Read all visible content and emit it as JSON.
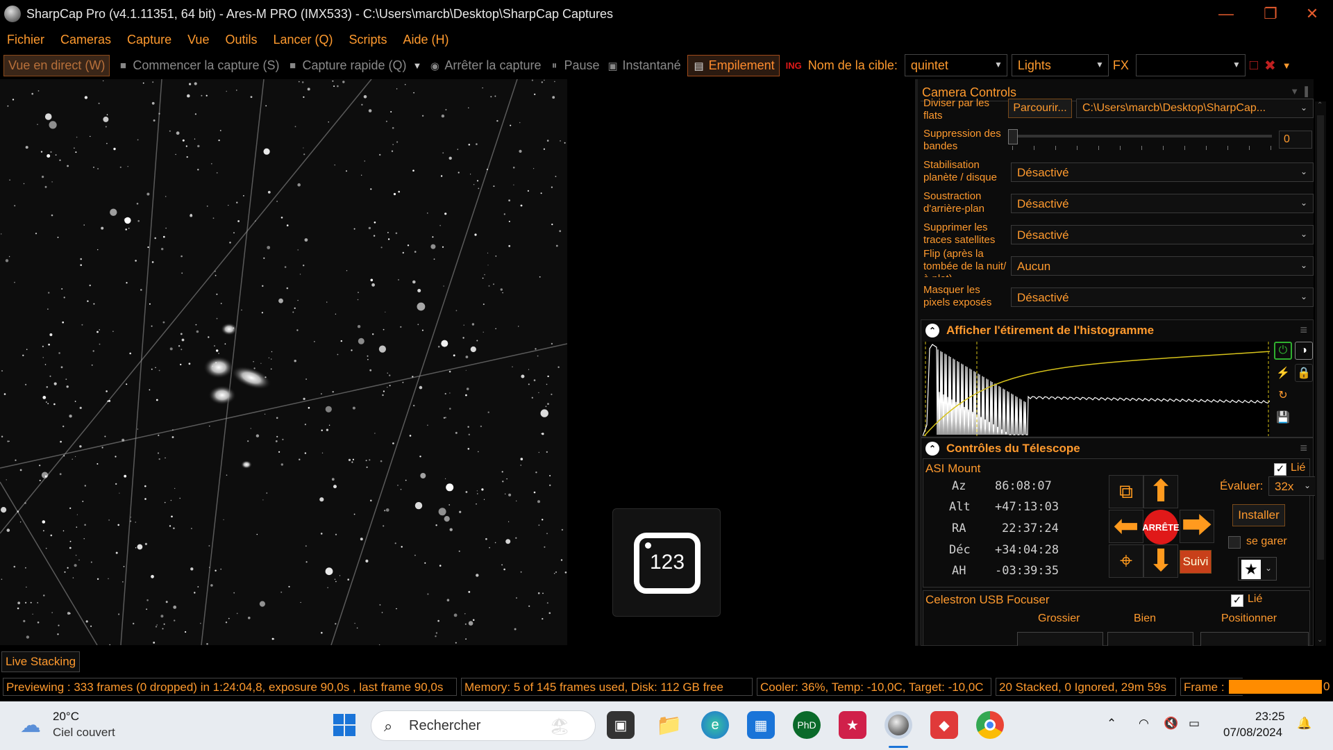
{
  "window": {
    "title": "SharpCap Pro (v4.1.11351, 64 bit) - Ares-M PRO (IMX533) - C:\\Users\\marcb\\Desktop\\SharpCap Captures",
    "controls": [
      "minimize-icon",
      "restore-icon",
      "close-icon"
    ]
  },
  "menu": [
    "Fichier",
    "Cameras",
    "Capture",
    "Vue",
    "Outils",
    "Lancer (Q)",
    "Scripts",
    "Aide (H)"
  ],
  "toolbar": {
    "live_view": "Vue en direct (W)",
    "start_capture": "Commencer la capture (S)",
    "quick_capture": "Capture rapide (Q)",
    "stop_capture": "Arrêter la capture",
    "pause": "Pause",
    "snapshot": "Instantané",
    "stacking": "Empilement",
    "target_label": "Nom de la cible:",
    "target_value": "quintet",
    "frame_type": "Lights",
    "fx_label": "FX",
    "fx_value": ""
  },
  "panel": {
    "title": "Camera Controls",
    "rows": [
      {
        "label": "Diviser par les flats",
        "button": "Parcourir...",
        "value": "C:\\Users\\marcb\\Desktop\\SharpCap..."
      },
      {
        "label": "Suppression des bandes",
        "value": "0"
      },
      {
        "label": "Stabilisation planète / disque",
        "value": "Désactivé"
      },
      {
        "label": "Soustraction d'arrière-plan",
        "value": "Désactivé"
      },
      {
        "label": "Supprimer les traces satellites",
        "value": "Désactivé"
      },
      {
        "label": "Flip (après la tombée de la nuit/à plat)",
        "value": "Aucun"
      },
      {
        "label": "Masquer les pixels exposés",
        "value": "Désactivé"
      }
    ],
    "histogram": {
      "title": "Afficher l'étirement de l'histogramme"
    },
    "telescope": {
      "title": "Contrôles du Télescope",
      "mount_name": "ASI Mount",
      "linked_label": "Lié",
      "coords": [
        {
          "label": "Az",
          "value": "86:08:07"
        },
        {
          "label": "Alt",
          "value": "+47:13:03"
        },
        {
          "label": "RA",
          "value": "22:37:24"
        },
        {
          "label": "Déc",
          "value": "+34:04:28"
        },
        {
          "label": "AH",
          "value": "-03:39:35"
        }
      ],
      "rate_label": "Évaluer:",
      "rate_value": "32x",
      "install_button": "Installer",
      "park_label": "se garer",
      "stop_label": "ARRÊTE",
      "tracking_button": "Suivi"
    },
    "focuser": {
      "name": "Celestron USB Focuser",
      "linked_label": "Lié",
      "col_coarse": "Grossier",
      "col_fine": "Bien",
      "col_position": "Positionner"
    }
  },
  "bottom_tab": "Live Stacking",
  "status": {
    "preview": "Previewing : 333 frames (0 dropped) in 1:24:04,8, exposure 90,0s , last frame 90,0s",
    "memory": "Memory: 5 of 145 frames used, Disk: 112 GB free",
    "cooler": "Cooler: 36%, Temp: -10,0C, Target: -10,0C",
    "stacked": "20 Stacked, 0 Ignored, 29m 59s",
    "frame_label": "Frame :",
    "frame_tail": "0"
  },
  "badge_number": "123",
  "taskbar": {
    "weather_temp": "20°C",
    "weather_desc": "Ciel couvert",
    "search_placeholder": "Rechercher",
    "time": "23:25",
    "date": "07/08/2024"
  },
  "colors": {
    "accent": "#ff9a2e",
    "stop_red": "#e01919",
    "frame_progress": "#ff8c00"
  }
}
